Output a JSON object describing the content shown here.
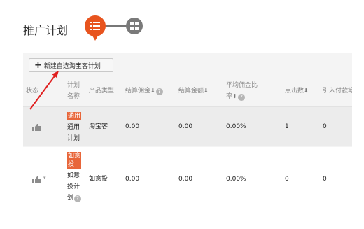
{
  "page": {
    "title": "推广计划"
  },
  "view_toggle": {
    "active": "list",
    "accent_color": "#e8541e"
  },
  "toolbar": {
    "new_plan_label": "新建自选淘宝客计划"
  },
  "table": {
    "columns": {
      "status": "状态",
      "plan_name": "计划\n名称",
      "product_type": "产品类型",
      "settlement_commission": "结算佣金",
      "settlement_amount": "结算金额",
      "avg_commission_rate": "平均佣金比\n率",
      "clicks": "点击数",
      "paid_orders": "引入付款笔"
    },
    "rows": [
      {
        "tag": "通用",
        "plan_name": "通用\n计划",
        "product_type": "淘宝客",
        "settlement_commission": "0.00",
        "settlement_amount": "0.00",
        "avg_commission_rate": "0.00%",
        "clicks": "1",
        "paid_orders": "0"
      },
      {
        "tag": "如意\n投",
        "plan_name": "如意\n投计\n划",
        "product_type": "如意投",
        "settlement_commission": "0.00",
        "settlement_amount": "0.00",
        "avg_commission_rate": "0.00%",
        "clicks": "0",
        "paid_orders": "0"
      }
    ]
  }
}
